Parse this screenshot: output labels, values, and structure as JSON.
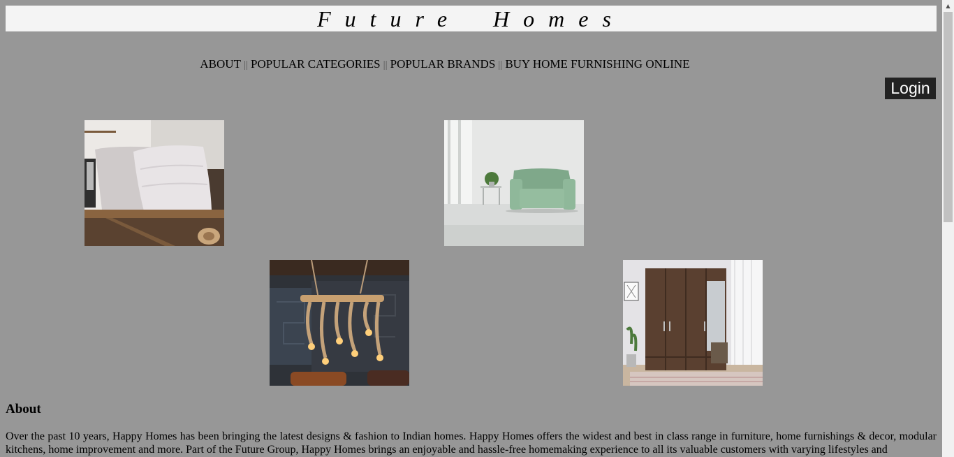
{
  "header": {
    "title": "Future Homes"
  },
  "nav": {
    "items": [
      {
        "label": "ABOUT"
      },
      {
        "label": "POPULAR CATEGORIES"
      },
      {
        "label": "POPULAR BRANDS"
      },
      {
        "label": "BUY HOME FURNISHING ONLINE"
      }
    ],
    "separator": "||"
  },
  "login": {
    "label": "Login"
  },
  "gallery": {
    "images": [
      {
        "subject": "cushions-on-shelf"
      },
      {
        "subject": "green-armchair"
      },
      {
        "subject": "rope-chandelier"
      },
      {
        "subject": "wooden-wardrobe"
      }
    ]
  },
  "about": {
    "heading": "About",
    "text": "Over the past 10 years, Happy Homes has been bringing the latest designs & fashion to Indian homes. Happy Homes offers the widest and best in class range in furniture, home furnishings & decor, modular kitchens, home improvement and more. Part of the Future Group, Happy Homes brings an enjoyable and hassle-free homemaking experience to all its valuable customers with varying lifestyles and"
  },
  "colors": {
    "page_background": "#979797",
    "title_bar": "#f4f4f4",
    "login_button": "#222222"
  }
}
